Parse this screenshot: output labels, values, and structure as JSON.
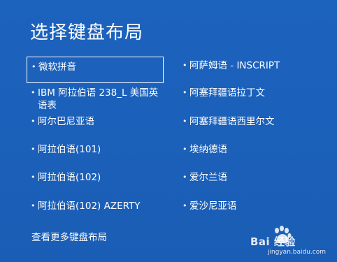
{
  "title": "选择键盘布局",
  "bullet_glyph": "•",
  "left_column": [
    {
      "label": "微软拼音",
      "selected": true
    },
    {
      "label": "IBM 阿拉伯语 238_L 美国英语表",
      "selected": false
    },
    {
      "label": "阿尔巴尼亚语",
      "selected": false
    },
    {
      "label": "阿拉伯语(101)",
      "selected": false
    },
    {
      "label": "阿拉伯语(102)",
      "selected": false
    },
    {
      "label": "阿拉伯语(102) AZERTY",
      "selected": false
    }
  ],
  "right_column": [
    {
      "label": "阿萨姆语 - INSCRIPT"
    },
    {
      "label": "阿塞拜疆语拉丁文"
    },
    {
      "label": "阿塞拜疆语西里尔文"
    },
    {
      "label": "埃纳德语"
    },
    {
      "label": "爱尔兰语"
    },
    {
      "label": "爱沙尼亚语"
    }
  ],
  "more_link": "查看更多键盘布局",
  "watermark": {
    "brand": "Bai 经验",
    "url": "jingyan.baidu.com"
  },
  "colors": {
    "background": "#1a5fb8",
    "text": "#ffffff"
  }
}
